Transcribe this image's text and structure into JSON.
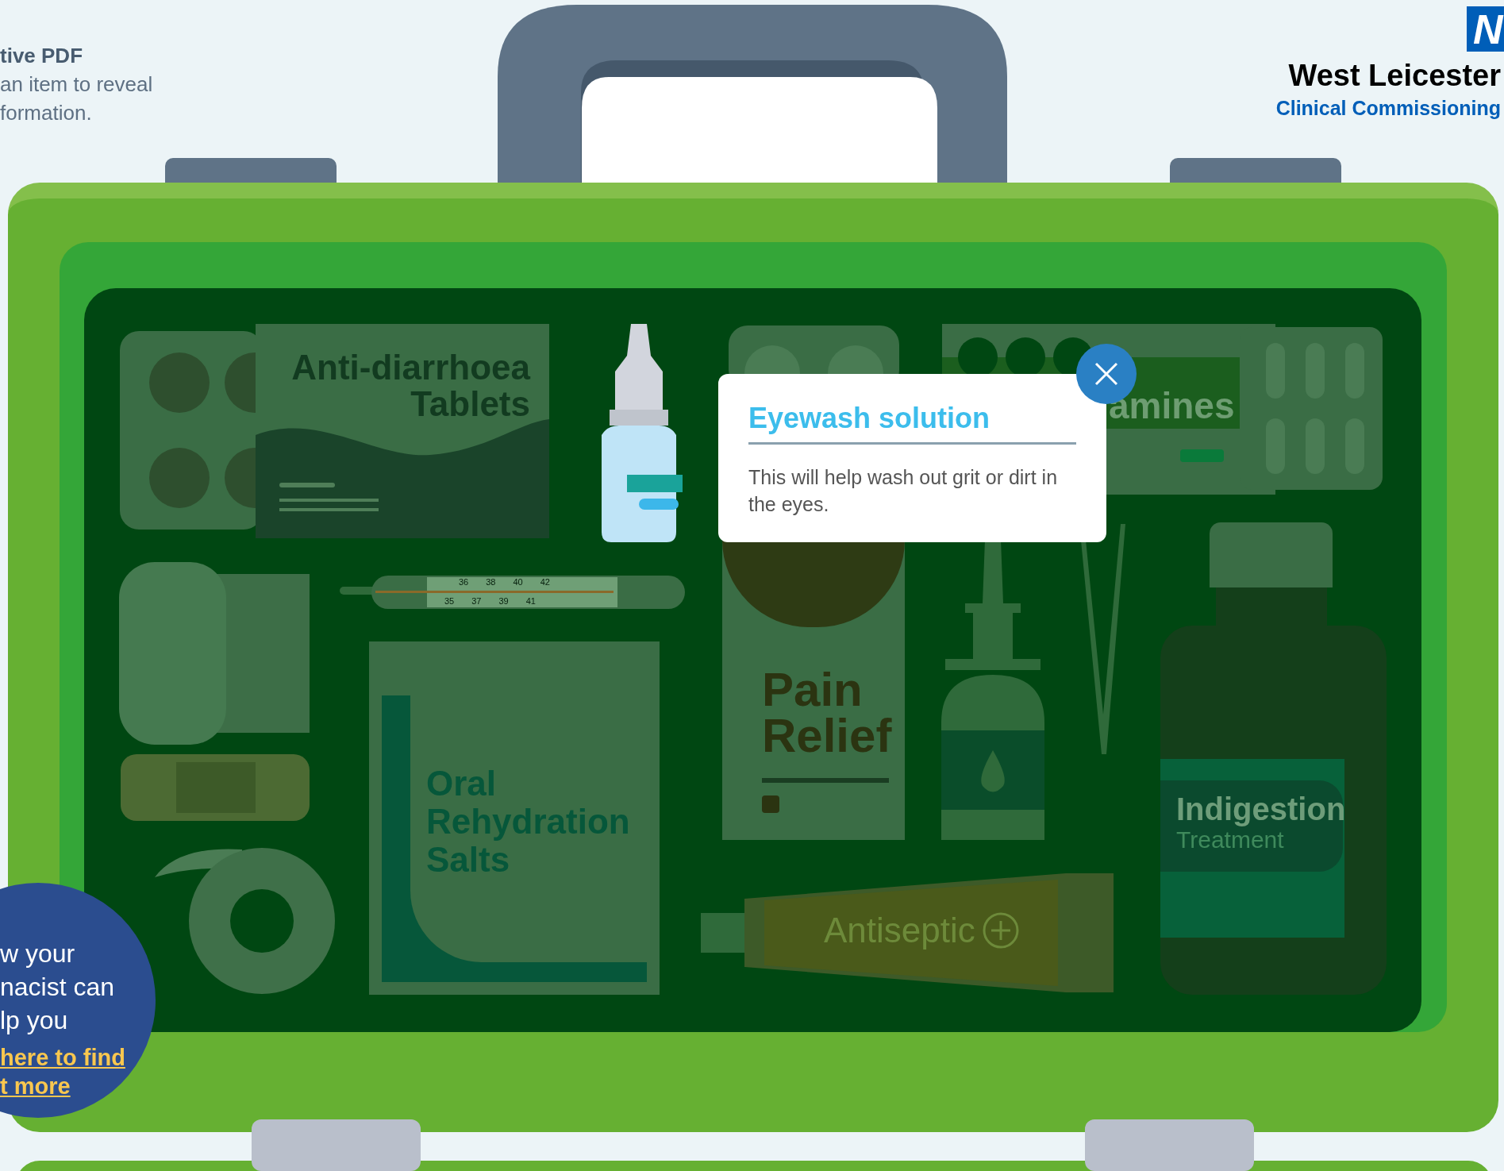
{
  "intro": {
    "title": "tive PDF",
    "lines": [
      "an item to reveal",
      "formation."
    ]
  },
  "logo": {
    "mark": "N",
    "name": "West Leicester",
    "subtitle": "Clinical Commissioning"
  },
  "kit": {
    "items": [
      {
        "kind": "blister"
      },
      {
        "kind": "tablets",
        "lines": [
          "Anti-diarrhoea",
          "Tablets"
        ]
      },
      {
        "kind": "eyedrops"
      },
      {
        "kind": "pillpack"
      },
      {
        "kind": "antihistamine",
        "lines": [
          "amines"
        ]
      },
      {
        "kind": "capsules"
      },
      {
        "kind": "gauze"
      },
      {
        "kind": "thermometer",
        "upper": [
          "36",
          "38",
          "40",
          "42"
        ],
        "lower": [
          "35",
          "37",
          "39",
          "41"
        ]
      },
      {
        "kind": "plaster"
      },
      {
        "kind": "tape"
      },
      {
        "kind": "sachet",
        "lines": [
          "Oral",
          "Rehydration",
          "Salts"
        ]
      },
      {
        "kind": "painrelief",
        "lines": [
          "Pain",
          "Relief"
        ]
      },
      {
        "kind": "spray"
      },
      {
        "kind": "tweezers"
      },
      {
        "kind": "indigestion",
        "lines": [
          "Indigestion",
          "Treatment"
        ]
      },
      {
        "kind": "antiseptic",
        "lines": [
          "Antiseptic"
        ]
      }
    ]
  },
  "popup": {
    "title": "Eyewash solution",
    "body": "This will help wash out grit or dirt in the eyes."
  },
  "promo": {
    "lines": [
      "w your",
      "nacist can",
      "lp you"
    ],
    "link": [
      "here to find",
      "t more"
    ]
  }
}
